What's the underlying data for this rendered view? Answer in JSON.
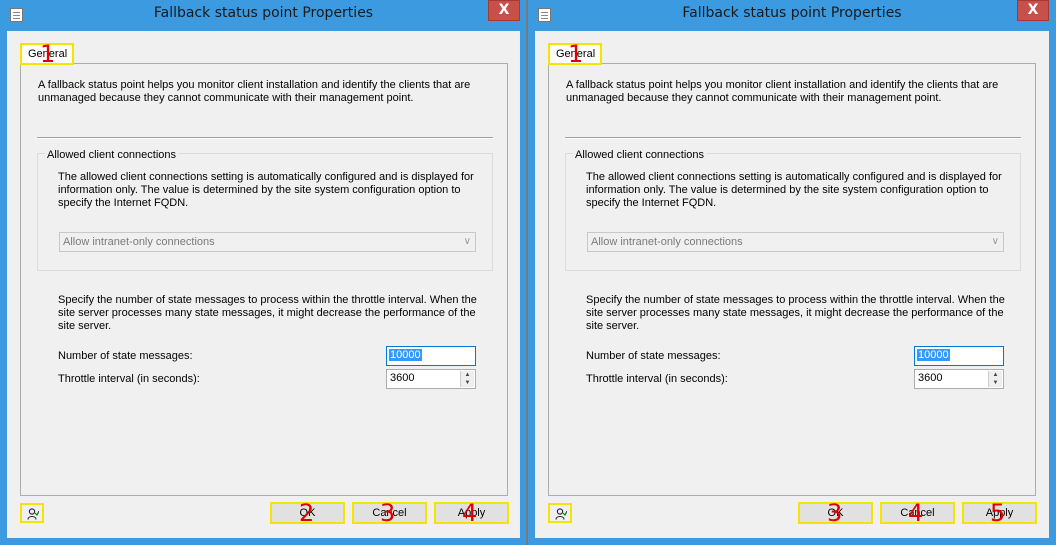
{
  "dialogs": [
    {
      "title": "Fallback status point Properties",
      "close_label": "X",
      "tab_label": "General",
      "intro": "A fallback status point helps you monitor client installation and identify the clients that are unmanaged because they cannot communicate with their management point.",
      "group_label": "Allowed client connections",
      "group_text": "The allowed client connections setting is automatically configured and is displayed for information only. The value is determined by the site system configuration option to specify the Internet FQDN.",
      "combo_value": "Allow intranet-only connections",
      "throttle_text": "Specify the number of state messages to process within the throttle interval. When the site server processes many state messages, it might decrease the performance of the site server.",
      "num_label": "Number of state messages:",
      "num_value": "10000",
      "interval_label": "Throttle interval (in seconds):",
      "interval_value": "3600",
      "ok_label": "OK",
      "cancel_label": "Cancel",
      "apply_label": "Apply",
      "marks": {
        "tab": "1",
        "ok": "2",
        "cancel": "3",
        "apply": "4"
      }
    },
    {
      "title": "Fallback status point Properties",
      "close_label": "X",
      "tab_label": "General",
      "intro": "A fallback status point helps you monitor client installation and identify the clients that are unmanaged because they cannot communicate with their management point.",
      "group_label": "Allowed client connections",
      "group_text": "The allowed client connections setting is automatically configured and is displayed for information only. The value is determined by the site system configuration option to specify the Internet FQDN.",
      "combo_value": "Allow intranet-only connections",
      "throttle_text": "Specify the number of state messages to process within the throttle interval. When the site server processes many state messages, it might decrease the performance of the site server.",
      "num_label": "Number of state messages:",
      "num_value": "10000",
      "interval_label": "Throttle interval (in seconds):",
      "interval_value": "3600",
      "ok_label": "OK",
      "cancel_label": "Cancel",
      "apply_label": "Apply",
      "marks": {
        "tab": "1",
        "ok": "3",
        "cancel": "4",
        "apply": "5"
      }
    }
  ],
  "colors": {
    "titlebar": "#3c9ae0",
    "close": "#c7504a",
    "highlight": "#f5e400",
    "mark": "#e00000",
    "selection": "#3399ff"
  },
  "icons": {
    "system": "properties-page-icon",
    "help": "person-help-icon",
    "spin_up": "chevron-up-icon",
    "spin_down": "chevron-down-icon",
    "combo": "chevron-down-icon"
  }
}
